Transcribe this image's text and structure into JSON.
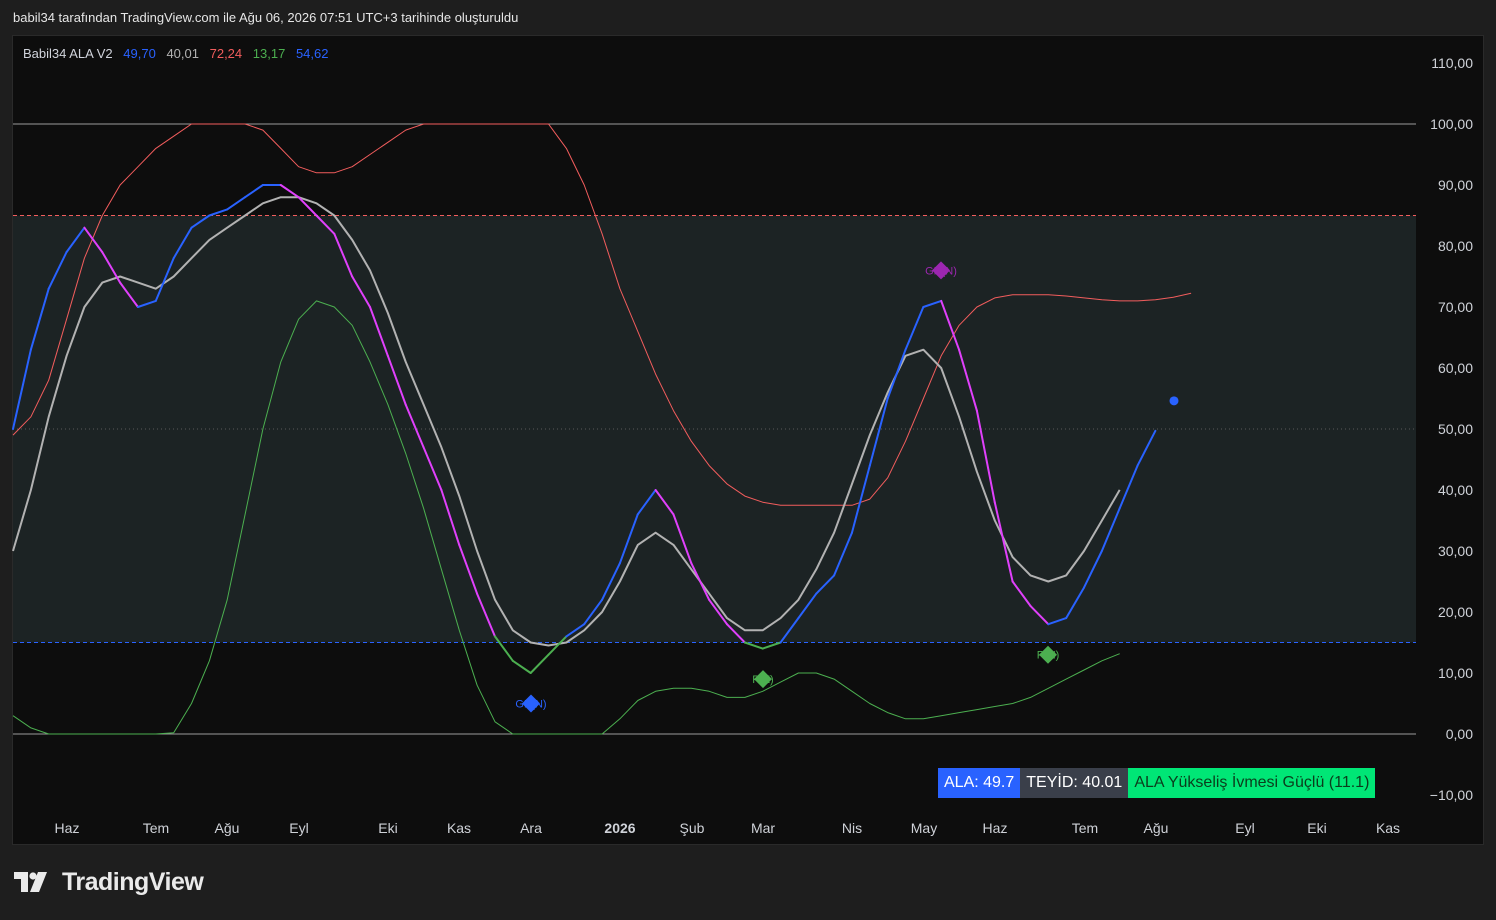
{
  "header": {
    "caption": "babil34 tarafından TradingView.com ile Ağu 06, 2026 07:51 UTC+3 tarihinde oluşturuldu"
  },
  "legend": {
    "name": "Babil34 ALA V2",
    "v1": "49,70",
    "v2": "40,01",
    "v3": "72,24",
    "v4": "13,17",
    "v5": "54,62"
  },
  "info_panel": {
    "ala": "ALA: 49.7",
    "teyid": "TEYİD: 40.01",
    "status": "ALA Yükseliş İvmesi Güçlü (11.1)"
  },
  "logo": {
    "text": "TradingView"
  },
  "colors": {
    "blue": "#2962ff",
    "magenta": "#e040fb",
    "gray": "#b2b2b2",
    "red": "#f25d5d",
    "green": "#4caf50",
    "background": "#0d0d0d"
  },
  "chart_data": {
    "type": "line",
    "ylim": [
      -10,
      110
    ],
    "y_ticks": [
      "110,00",
      "100,00",
      "90,00",
      "80,00",
      "70,00",
      "60,00",
      "50,00",
      "40,00",
      "30,00",
      "20,00",
      "10,00",
      "0,00",
      "−10,00"
    ],
    "x_ticks": [
      "Haz",
      "Tem",
      "Ağu",
      "Eyl",
      "Eki",
      "Kas",
      "Ara",
      "2026",
      "Şub",
      "Mar",
      "Nis",
      "May",
      "Haz",
      "Tem",
      "Ağu",
      "Eyl",
      "Eki",
      "Kas"
    ],
    "bands": {
      "upper": 85,
      "lower": 15,
      "mid": 50,
      "top": 100,
      "bottom": 0
    },
    "series": [
      {
        "values": [
          50,
          63,
          73,
          79,
          83,
          79,
          74,
          70,
          71,
          78,
          83,
          85,
          86,
          88,
          90,
          90,
          88,
          85,
          82,
          75,
          70,
          62,
          54,
          47,
          40,
          31,
          23,
          16,
          12,
          10,
          13,
          16,
          18,
          22,
          28,
          36,
          40,
          36,
          28,
          22,
          18,
          15,
          14,
          15,
          19,
          23,
          26,
          33,
          44,
          55,
          63,
          70,
          71,
          63,
          53,
          38,
          25,
          21,
          18,
          19,
          24,
          30,
          37,
          44,
          49.7
        ]
      },
      {
        "values": [
          30,
          40,
          52,
          62,
          70,
          74,
          75,
          74,
          73,
          75,
          78,
          81,
          83,
          85,
          87,
          88,
          88,
          87,
          85,
          81,
          76,
          69,
          61,
          54,
          47,
          39,
          30,
          22,
          17,
          15,
          14.5,
          15,
          17,
          20,
          25,
          31,
          33,
          31,
          27,
          23,
          19,
          17,
          17,
          19,
          22,
          27,
          33,
          41,
          49,
          56,
          62,
          63,
          60,
          52,
          43,
          35,
          29,
          26,
          25,
          26,
          30,
          35,
          40.01
        ]
      },
      {
        "values": [
          49,
          52,
          58,
          68,
          78,
          85,
          90,
          93,
          96,
          98,
          100,
          100,
          100,
          100,
          99,
          96,
          93,
          92,
          92,
          93,
          95,
          97,
          99,
          100,
          100,
          100,
          100,
          100,
          100,
          100,
          100,
          96,
          90,
          82,
          73,
          66,
          59,
          53,
          48,
          44,
          41,
          39,
          38,
          37.5,
          37.5,
          37.5,
          37.5,
          37.5,
          38.5,
          42,
          48,
          55,
          62,
          67,
          70,
          71.5,
          72,
          72,
          72,
          71.8,
          71.5,
          71.2,
          71,
          71,
          71.2,
          71.6,
          72.24
        ]
      },
      {
        "values": [
          3,
          1,
          0,
          0,
          0,
          0,
          0,
          0,
          0,
          0.2,
          5,
          12,
          22,
          36,
          50,
          61,
          68,
          71,
          70,
          67,
          61,
          54,
          46,
          37,
          27,
          17,
          8,
          2,
          0,
          0,
          0,
          0,
          0,
          0,
          2.5,
          5.5,
          7,
          7.5,
          7.5,
          7,
          6,
          6,
          7,
          8.5,
          10,
          10,
          9,
          7,
          5,
          3.5,
          2.5,
          2.5,
          3,
          3.5,
          4,
          4.5,
          5,
          6,
          7.5,
          9,
          10.5,
          12,
          13.17
        ]
      }
    ],
    "markers": [
      {
        "label": "GP(N)",
        "x": "Ara",
        "y": 5
      },
      {
        "label": "P(Z)",
        "x": "Mar",
        "y": 9
      },
      {
        "label": "GN(N)",
        "x": "May",
        "y": 76
      },
      {
        "label": "P(N)",
        "x": "Haz",
        "y": 13
      }
    ],
    "forecast_point": 54.62
  }
}
